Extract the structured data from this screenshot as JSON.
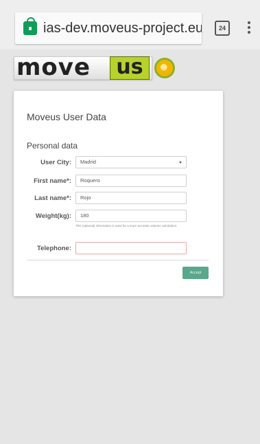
{
  "browser": {
    "url": "ias-dev.moveus-project.eu/I",
    "tab_count": "24"
  },
  "logo": {
    "text_move": "move",
    "text_us": "us",
    "colors": {
      "accent": "#b7d22b",
      "ball": "#f2b600"
    }
  },
  "card": {
    "title": "Moveus User Data",
    "section": "Personal data",
    "fields": {
      "city": {
        "label": "User City:",
        "value": "Madrid"
      },
      "first_name": {
        "label": "First name*:",
        "value": "Roquero"
      },
      "last_name": {
        "label": "Last name*:",
        "value": "Rojo"
      },
      "weight": {
        "label": "Weight(kg):",
        "value": "180"
      },
      "telephone": {
        "label": "Telephone:",
        "value": ""
      }
    },
    "help_text": "This (optional) information is used for a more accurate calories calculation.",
    "accept_label": "Accept",
    "colors": {
      "accept_bg": "#5aa88c",
      "invalid_border": "#e8a7a7"
    }
  },
  "icons": {
    "lock": "lock-icon",
    "tabs": "tabs-icon",
    "menu": "overflow-menu-icon",
    "select_caret": "chevron-down-icon"
  }
}
